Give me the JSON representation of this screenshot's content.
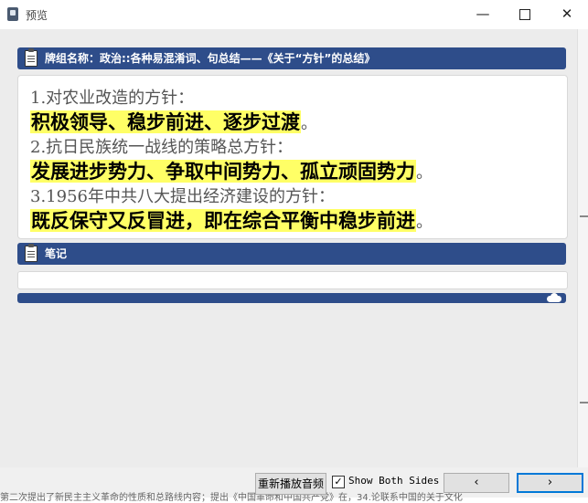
{
  "window": {
    "title": "预览",
    "minimize": "—",
    "close": "✕"
  },
  "deck_section": {
    "label": "牌组名称：政治::各种易混淆词、句总结——《关于“方针”的总结》"
  },
  "card": {
    "items": [
      {
        "question": "1.对农业改造的方针：",
        "answer": "积极领导、稳步前进、逐步过渡",
        "end": "。"
      },
      {
        "question": "2.抗日民族统一战线的策略总方针：",
        "answer": "发展进步势力、争取中间势力、孤立顽固势力",
        "end": "。"
      },
      {
        "question": "3.1956年中共八大提出经济建设的方针：",
        "answer": "既反保守又反冒进，即在综合平衡中稳步前进",
        "end": "。"
      }
    ]
  },
  "notes_section": {
    "label": "笔记"
  },
  "toolbar": {
    "replay_label": "重新播放音频",
    "show_both_sides_label": "Show Both Sides",
    "show_both_sides_checked": true,
    "checkbox_mark": "✓",
    "prev_label": "‹",
    "next_label": "›"
  },
  "background_text": "第二次提出了新民主主义革命的性质和总路线内容；提出《中国革命和中国共产党》在，34.论联系中国的关于文化"
}
